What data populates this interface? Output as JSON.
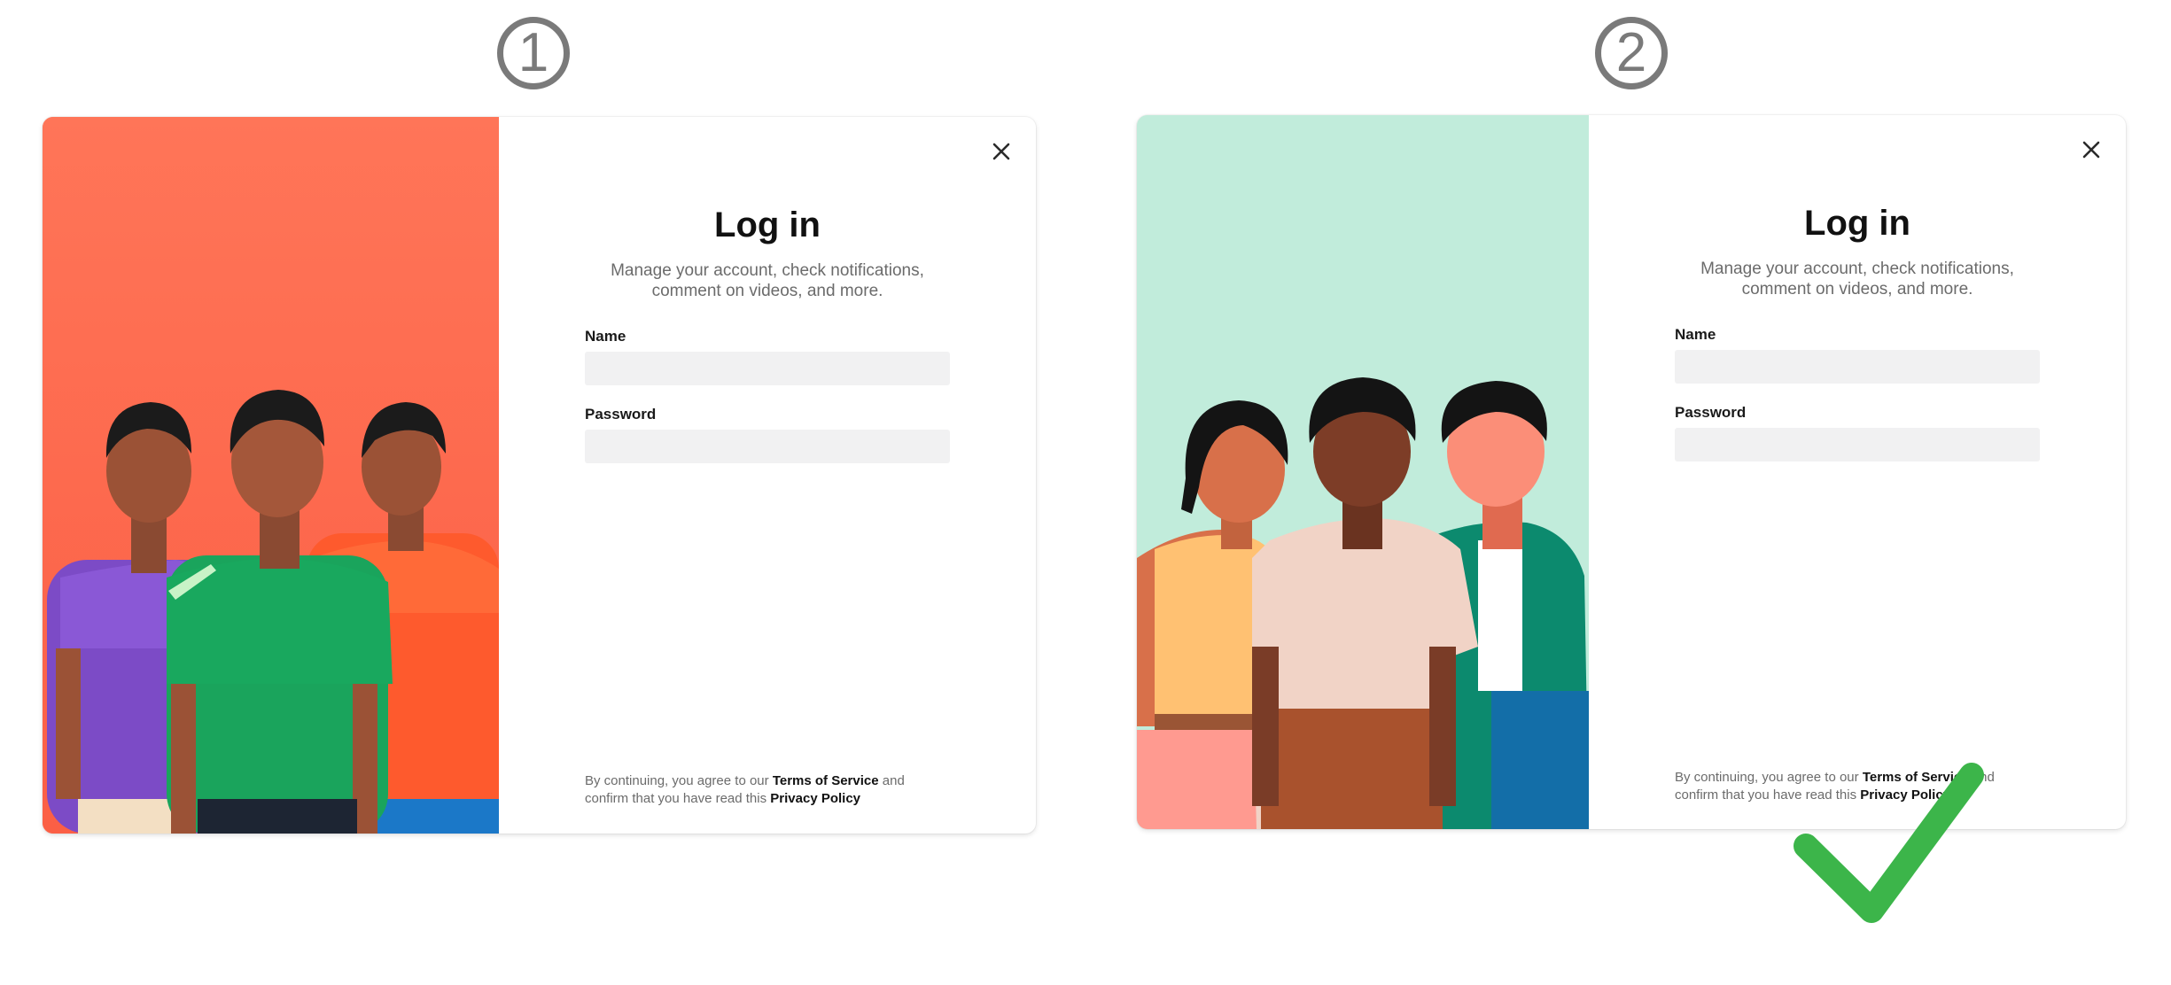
{
  "steps": [
    {
      "number": "1"
    },
    {
      "number": "2"
    }
  ],
  "login": {
    "title": "Log in",
    "subtitle_line1": "Manage your account, check notifications,",
    "subtitle_line2": "comment on videos, and more.",
    "name_label": "Name",
    "name_value": "",
    "password_label": "Password",
    "password_value": "",
    "legal_prefix": "By continuing, you agree to our",
    "terms_link": "Terms of Service",
    "legal_and": "and",
    "legal_middle": "confirm that you have read this",
    "privacy_link": "Privacy Policy"
  },
  "icons": {
    "close": "close-icon",
    "check": "checkmark-icon"
  },
  "colors": {
    "option1_background": "#ff7055",
    "option2_background": "#c1ecdb",
    "checkmark": "#3cb54a",
    "step_number": "#7a7a7a"
  }
}
